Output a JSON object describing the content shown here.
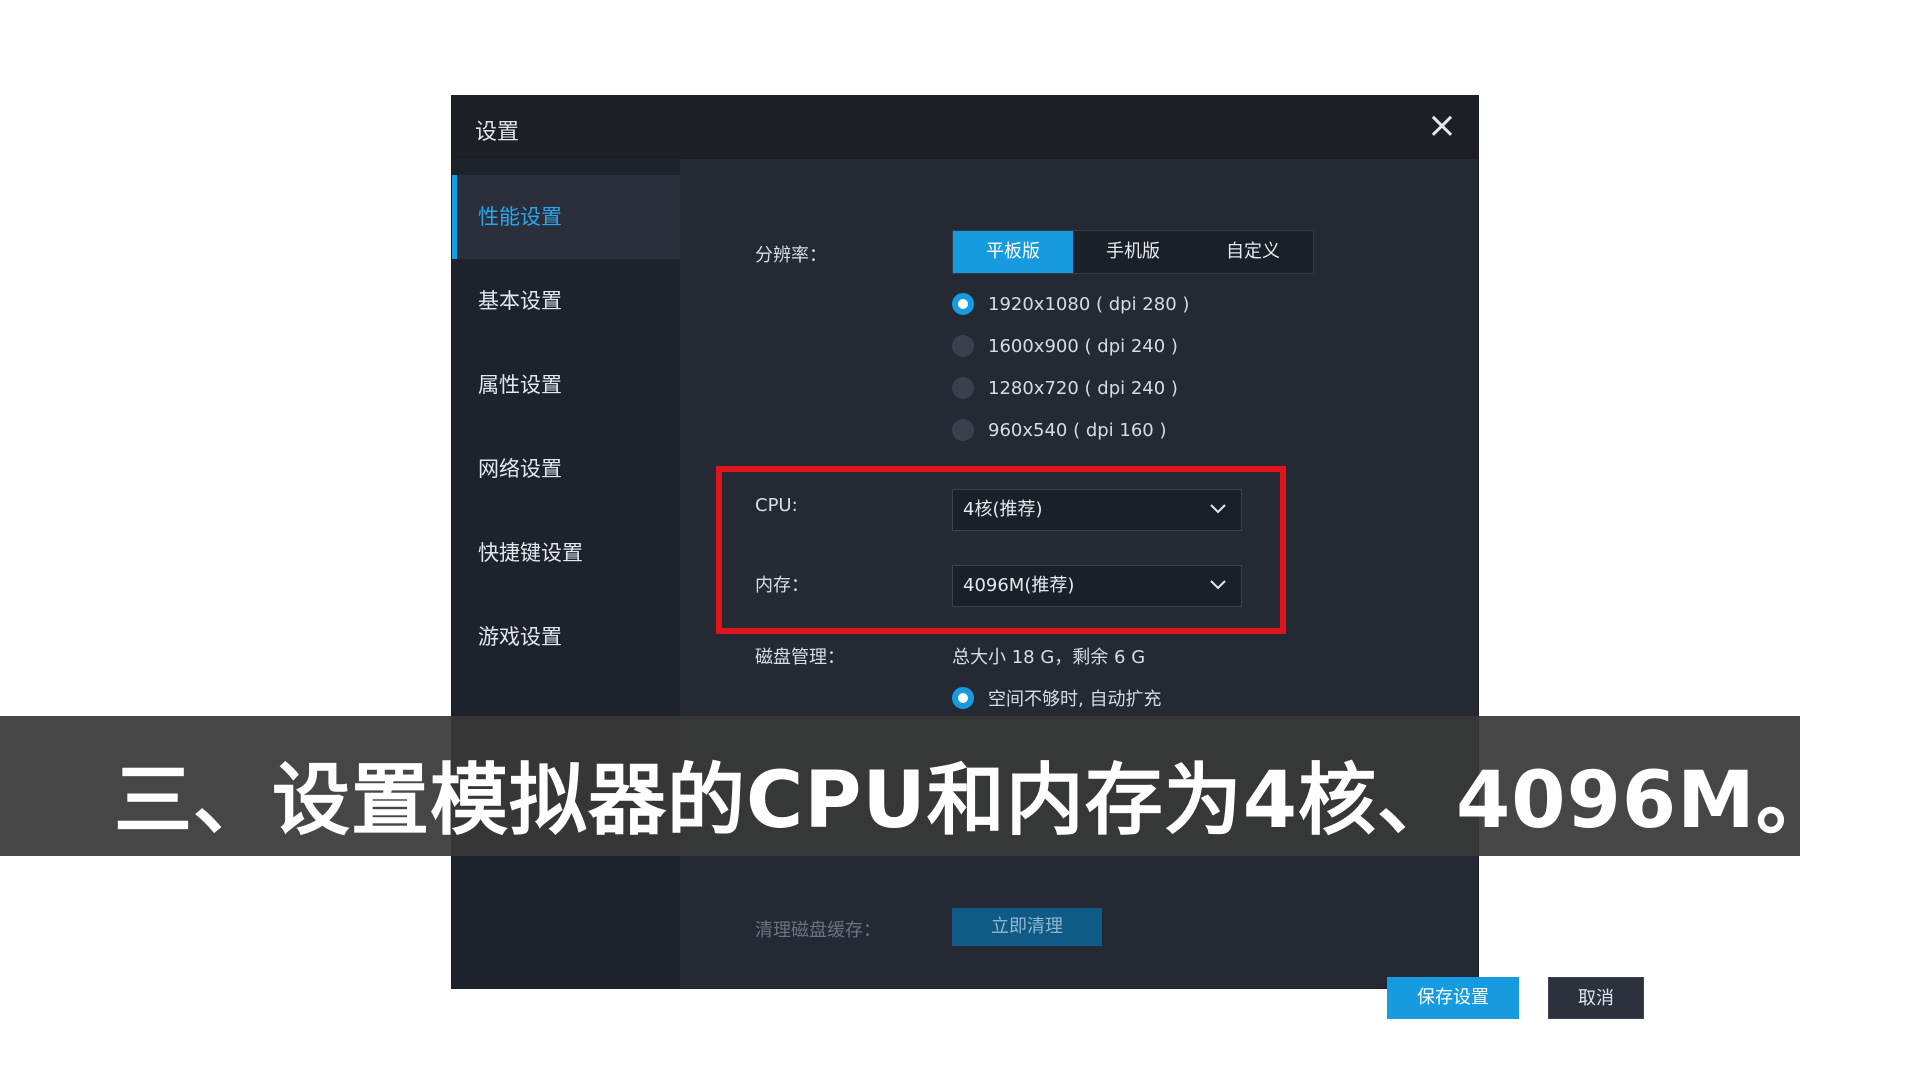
{
  "window": {
    "title": "设置"
  },
  "sidebar": {
    "items": [
      {
        "label": "性能设置",
        "active": true
      },
      {
        "label": "基本设置"
      },
      {
        "label": "属性设置"
      },
      {
        "label": "网络设置"
      },
      {
        "label": "快捷键设置"
      },
      {
        "label": "游戏设置"
      }
    ]
  },
  "resolution": {
    "label": "分辨率：",
    "tabs": [
      "平板版",
      "手机版",
      "自定义"
    ],
    "selected_tab": "平板版",
    "options": [
      "1920x1080 ( dpi 280 )",
      "1600x900 ( dpi 240 )",
      "1280x720 ( dpi 240 )",
      "960x540 ( dpi 160 )"
    ],
    "selected_option": "1920x1080 ( dpi 280 )"
  },
  "cpu": {
    "label": "CPU:",
    "value": "4核(推荐)"
  },
  "memory": {
    "label": "内存：",
    "value": "4096M(推荐)"
  },
  "disk": {
    "label": "磁盘管理：",
    "summary": "总大小 18 G，剩余 6 G",
    "auto_expand": "空间不够时, 自动扩充"
  },
  "cache": {
    "label": "清理磁盘缓存：",
    "button": "立即清理"
  },
  "footer": {
    "save": "保存设置",
    "cancel": "取消"
  },
  "caption": {
    "text": "三、设置模拟器的CPU和内存为4核、4096M。"
  },
  "colors": {
    "accent": "#169be0",
    "highlight": "#e0141b",
    "panel": "#242934"
  }
}
